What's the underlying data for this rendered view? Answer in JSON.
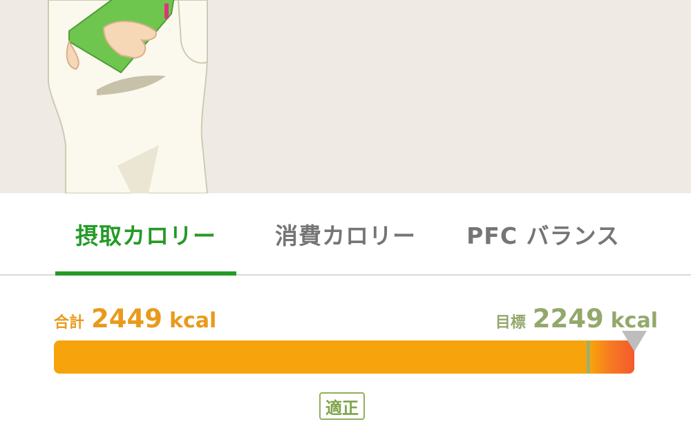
{
  "tabs": [
    {
      "label": "摂取カロリー",
      "active": true
    },
    {
      "label": "消費カロリー",
      "active": false
    },
    {
      "label": "PFC バランス",
      "active": false
    }
  ],
  "summary": {
    "total_label": "合計",
    "total_value": "2449",
    "target_label": "目標",
    "target_value": "2249",
    "unit": "kcal"
  },
  "bar": {
    "intake_kcal": 2449,
    "target_kcal": 2249,
    "status": "適正"
  },
  "colors": {
    "accent_green": "#249a27",
    "total_orange": "#e99a1c",
    "target_green": "#93a86b",
    "bar_orange": "#f7a30c",
    "bar_over_red": "#f35a2c"
  },
  "icons": [
    "target-marker-icon"
  ]
}
